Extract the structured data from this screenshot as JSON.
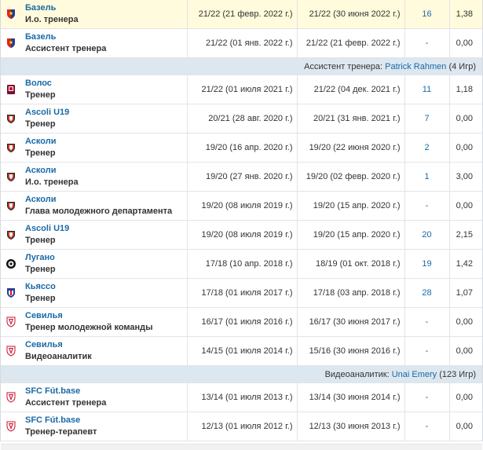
{
  "colors": {
    "link": "#1a6aa5",
    "highlight_row": "#fffbdc",
    "separator_row": "#dde7ef"
  },
  "rows": [
    {
      "kind": "row",
      "club": "Базель",
      "role": "И.о. тренера",
      "start": "21/22 (21 февр. 2022 г.)",
      "end": "21/22 (30 июня 2022 г.)",
      "games": "16",
      "ppm": "1,38",
      "crest": "basel-crest-icon",
      "highlight": true
    },
    {
      "kind": "row",
      "club": "Базель",
      "role": "Ассистент тренера",
      "start": "21/22 (01 янв. 2022 г.)",
      "end": "21/22 (21 февр. 2022 г.)",
      "games": "-",
      "ppm": "0,00",
      "crest": "basel-crest-icon",
      "highlight": false
    },
    {
      "kind": "sep",
      "prefix": "Ассистент тренера:",
      "name": "Patrick Rahmen",
      "suffix": "(4 Игр)"
    },
    {
      "kind": "row",
      "club": "Волос",
      "role": "Тренер",
      "start": "21/22 (01 июля 2021 г.)",
      "end": "21/22 (04 дек. 2021 г.)",
      "games": "11",
      "ppm": "1,18",
      "crest": "volos-crest-icon",
      "highlight": false
    },
    {
      "kind": "row",
      "club": "Ascoli U19",
      "role": "Тренер",
      "start": "20/21 (28 авг. 2020 г.)",
      "end": "20/21 (31 янв. 2021 г.)",
      "games": "7",
      "ppm": "0,00",
      "crest": "ascoli-crest-icon",
      "highlight": false
    },
    {
      "kind": "row",
      "club": "Асколи",
      "role": "Тренер",
      "start": "19/20 (16 апр. 2020 г.)",
      "end": "19/20 (22 июня 2020 г.)",
      "games": "2",
      "ppm": "0,00",
      "crest": "ascoli-crest-icon",
      "highlight": false
    },
    {
      "kind": "row",
      "club": "Асколи",
      "role": "И.о. тренера",
      "start": "19/20 (27 янв. 2020 г.)",
      "end": "19/20 (02 февр. 2020 г.)",
      "games": "1",
      "ppm": "3,00",
      "crest": "ascoli-crest-icon",
      "highlight": false
    },
    {
      "kind": "row",
      "club": "Асколи",
      "role": "Глава молодежного департамента",
      "start": "19/20 (08 июля 2019 г.)",
      "end": "19/20 (15 апр. 2020 г.)",
      "games": "-",
      "ppm": "0,00",
      "crest": "ascoli-crest-icon",
      "highlight": false
    },
    {
      "kind": "row",
      "club": "Ascoli U19",
      "role": "Тренер",
      "start": "19/20 (08 июля 2019 г.)",
      "end": "19/20 (15 апр. 2020 г.)",
      "games": "20",
      "ppm": "2,15",
      "crest": "ascoli-crest-icon",
      "highlight": false
    },
    {
      "kind": "row",
      "club": "Лугано",
      "role": "Тренер",
      "start": "17/18 (10 апр. 2018 г.)",
      "end": "18/19 (01 окт. 2018 г.)",
      "games": "19",
      "ppm": "1,42",
      "crest": "lugano-crest-icon",
      "highlight": false
    },
    {
      "kind": "row",
      "club": "Кьяссо",
      "role": "Тренер",
      "start": "17/18 (01 июля 2017 г.)",
      "end": "17/18 (03 апр. 2018 г.)",
      "games": "28",
      "ppm": "1,07",
      "crest": "chiasso-crest-icon",
      "highlight": false
    },
    {
      "kind": "row",
      "club": "Севилья",
      "role": "Тренер молодежной команды",
      "start": "16/17 (01 июля 2016 г.)",
      "end": "16/17 (30 июня 2017 г.)",
      "games": "-",
      "ppm": "0,00",
      "crest": "sevilla-crest-icon",
      "highlight": false
    },
    {
      "kind": "row",
      "club": "Севилья",
      "role": "Видеоаналитик",
      "start": "14/15 (01 июля 2014 г.)",
      "end": "15/16 (30 июня 2016 г.)",
      "games": "-",
      "ppm": "0,00",
      "crest": "sevilla-crest-icon",
      "highlight": false
    },
    {
      "kind": "sep",
      "prefix": "Видеоаналитик:",
      "name": "Unai Emery",
      "suffix": "(123 Игр)"
    },
    {
      "kind": "row",
      "club": "SFC Fút.base",
      "role": "Ассистент тренера",
      "start": "13/14 (01 июля 2013 г.)",
      "end": "13/14 (30 июня 2014 г.)",
      "games": "-",
      "ppm": "0,00",
      "crest": "sevilla-crest-icon",
      "highlight": false
    },
    {
      "kind": "row",
      "club": "SFC Fút.base",
      "role": "Тренер-терапевт",
      "start": "12/13 (01 июля 2012 г.)",
      "end": "12/13 (30 июня 2013 г.)",
      "games": "-",
      "ppm": "0,00",
      "crest": "sevilla-crest-icon",
      "highlight": false
    }
  ]
}
